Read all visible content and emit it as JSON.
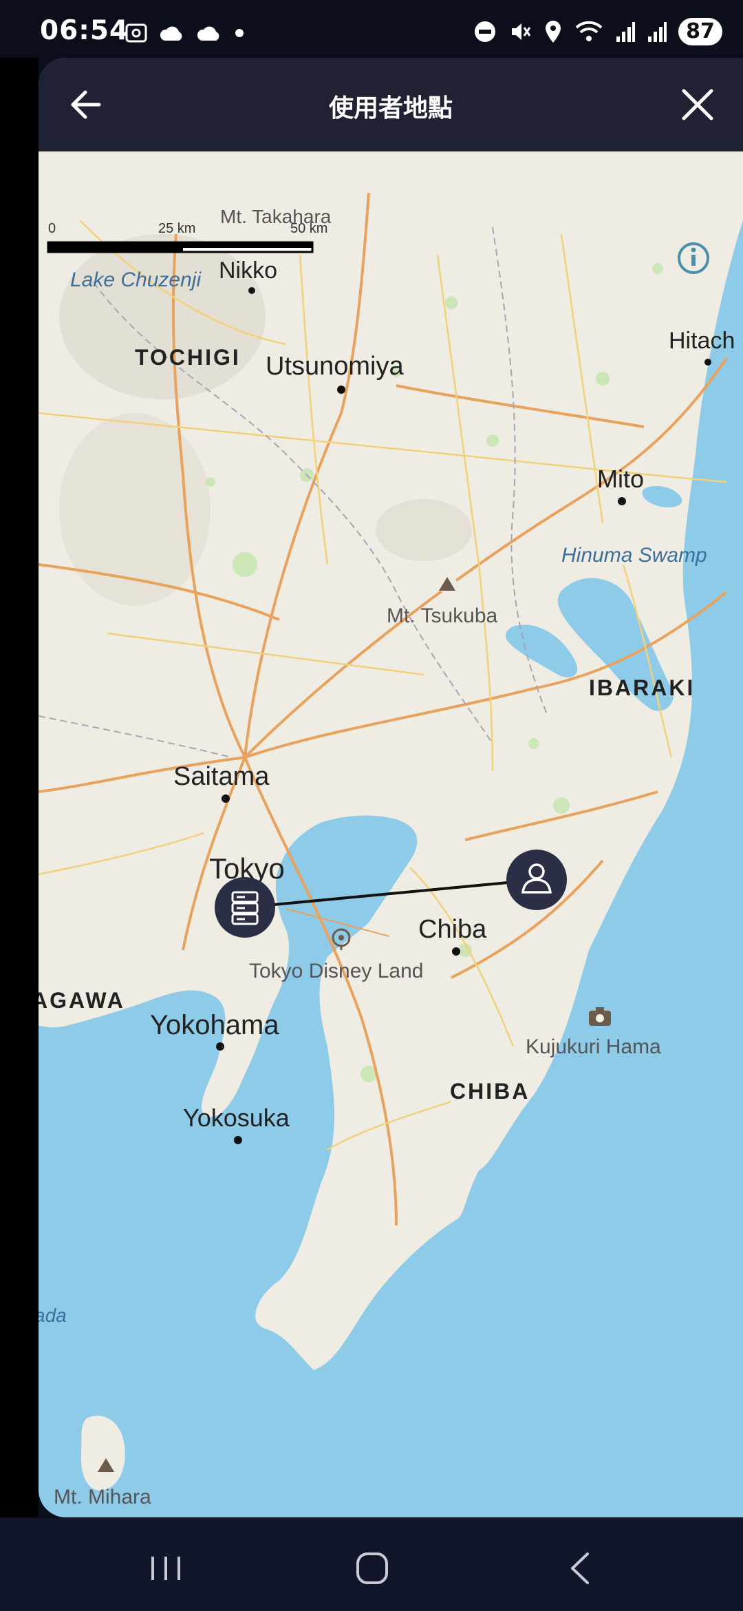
{
  "status_bar": {
    "time": "06:54",
    "battery": "87",
    "icons_left": [
      "screenshot-icon",
      "cloud-icon",
      "cloud-icon",
      "dot-icon"
    ],
    "icons_right": [
      "do-not-disturb-icon",
      "mute-icon",
      "location-icon",
      "wifi-icon",
      "signal-icon",
      "signal-icon"
    ]
  },
  "header": {
    "title": "使用者地點",
    "back_icon": "arrow-left-icon",
    "close_icon": "close-icon"
  },
  "scale_bar": {
    "zero": "0",
    "mid": "25 km",
    "end": "50 km"
  },
  "map": {
    "water_color": "#8ecbe9",
    "land_color": "#efece4",
    "regions": {
      "tochigi": "TOCHIGI",
      "ibaraki": "IBARAKI",
      "chiba": "CHIBA",
      "kanagawa": "AGAWA"
    },
    "cities": {
      "nikko": "Nikko",
      "utsunomiya": "Utsunomiya",
      "hitachi": "Hitach",
      "mito": "Mito",
      "saitama": "Saitama",
      "tokyo": "Tokyo",
      "chiba": "Chiba",
      "yokohama": "Yokohama",
      "yokosuka": "Yokosuka"
    },
    "places": {
      "mt_takahara": "Mt. Takahara",
      "lake_chuzenji": "Lake Chuzenji",
      "hinuma_swamp": "Hinuma Swamp",
      "mt_tsukuba": "Mt. Tsukuba",
      "tokyo_disney_land": "Tokyo Disney Land",
      "kujukuri_hama": "Kujukuri Hama",
      "mt_mihara": "Mt. Mihara",
      "ada": "ada"
    },
    "markers": {
      "server": "server-icon",
      "user": "user-icon"
    }
  },
  "nav_bar": {
    "recents_icon": "recents-icon",
    "home_icon": "home-icon",
    "back_icon": "back-chevron-icon"
  }
}
